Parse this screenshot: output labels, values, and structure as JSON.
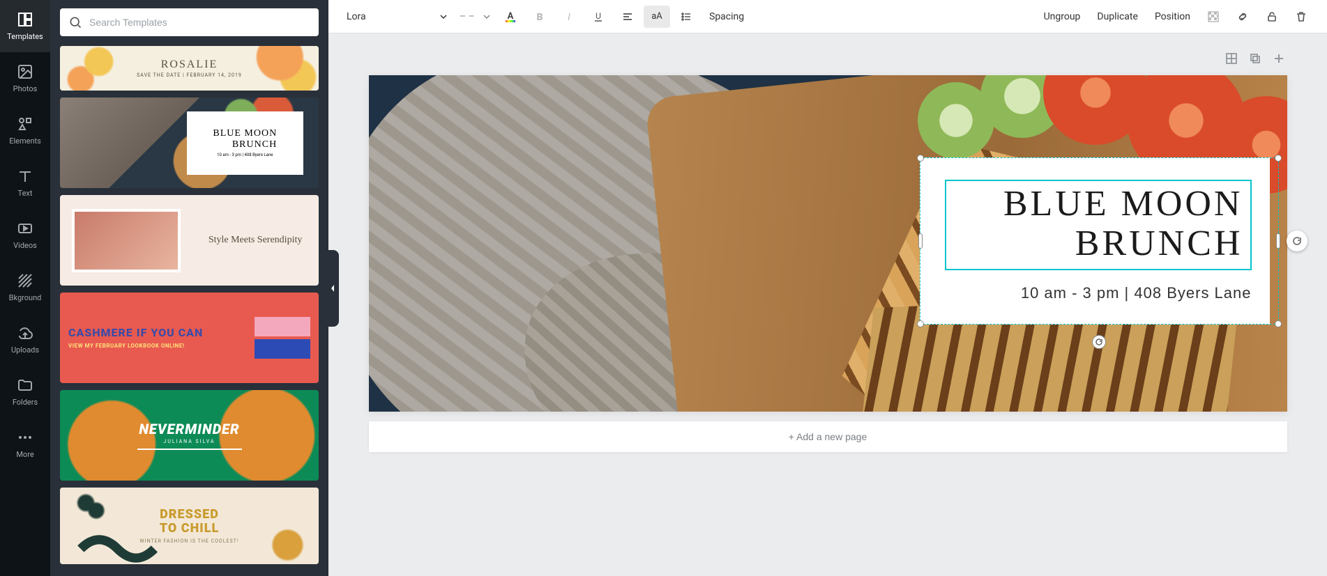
{
  "leftNav": {
    "items": [
      {
        "label": "Templates"
      },
      {
        "label": "Photos"
      },
      {
        "label": "Elements"
      },
      {
        "label": "Text"
      },
      {
        "label": "Videos"
      },
      {
        "label": "Bkground"
      },
      {
        "label": "Uploads"
      },
      {
        "label": "Folders"
      },
      {
        "label": "More"
      }
    ]
  },
  "search": {
    "placeholder": "Search Templates"
  },
  "templates": {
    "items": [
      {
        "title": "ROSALIE",
        "subtitle": "SAVE THE DATE | FEBRUARY 14, 2019"
      },
      {
        "title": "BLUE MOON BRUNCH",
        "subtitle": "10 am - 3 pm | 408 Byers Lane"
      },
      {
        "title": "Style Meets Serendipity"
      },
      {
        "title": "CASHMERE IF YOU CAN",
        "subtitle": "VIEW MY FEBRUARY LOOKBOOK ONLINE!"
      },
      {
        "title": "NEVERMINDER",
        "subtitle": "JULIANA SILVA"
      },
      {
        "title": "DRESSED TO CHILL",
        "subtitle": "WINTER FASHION IS THE COOLEST!"
      }
    ]
  },
  "toolbar": {
    "font": "Lora",
    "fontSize": "– –",
    "spacing": "Spacing",
    "ungroup": "Ungroup",
    "duplicate": "Duplicate",
    "position": "Position",
    "caseLabel": "aA"
  },
  "canvas": {
    "title_line1": "BLUE MOON",
    "title_line2": "BRUNCH",
    "subtitle": "10 am - 3 pm | 408 Byers Lane",
    "addPage": "+ Add a new page"
  }
}
